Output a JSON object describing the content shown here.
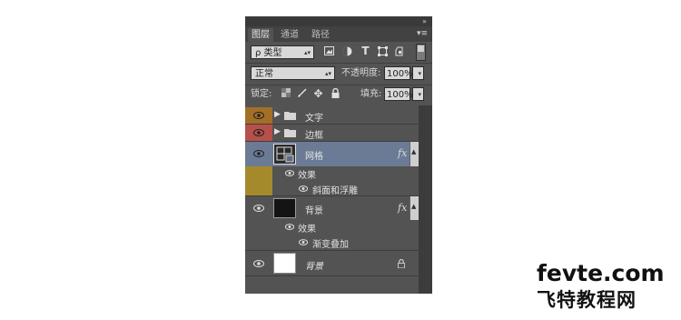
{
  "tabs": [
    {
      "label": "图层",
      "active": true
    },
    {
      "label": "通道",
      "active": false
    },
    {
      "label": "路径",
      "active": false
    }
  ],
  "filter": {
    "label": "ρ 类型"
  },
  "filter_icons": [
    "image-filter-icon",
    "adjustment-filter-icon",
    "type-filter-icon",
    "shape-filter-icon",
    "smart-object-filter-icon"
  ],
  "blend": {
    "mode": "正常",
    "opacity_label": "不透明度:",
    "opacity_value": "100%"
  },
  "lock": {
    "label": "锁定:",
    "fill_label": "填充:",
    "fill_value": "100%"
  },
  "layers": [
    {
      "name": "文字",
      "type": "group",
      "color": "#a36f28"
    },
    {
      "name": "边框",
      "type": "group",
      "color": "#b5504a"
    },
    {
      "name": "网格",
      "type": "layer",
      "color": "#a58a2b",
      "selected": true,
      "fx": "fx",
      "effects_label": "效果",
      "effects": [
        "斜面和浮雕"
      ]
    },
    {
      "name": "背景",
      "type": "layer",
      "fx": "fx",
      "effects_label": "效果",
      "effects": [
        "渐变叠加"
      ]
    },
    {
      "name": "背景",
      "type": "background",
      "locked": true
    }
  ],
  "watermark": {
    "line1": "fevte.com",
    "line2": "飞特教程网"
  }
}
